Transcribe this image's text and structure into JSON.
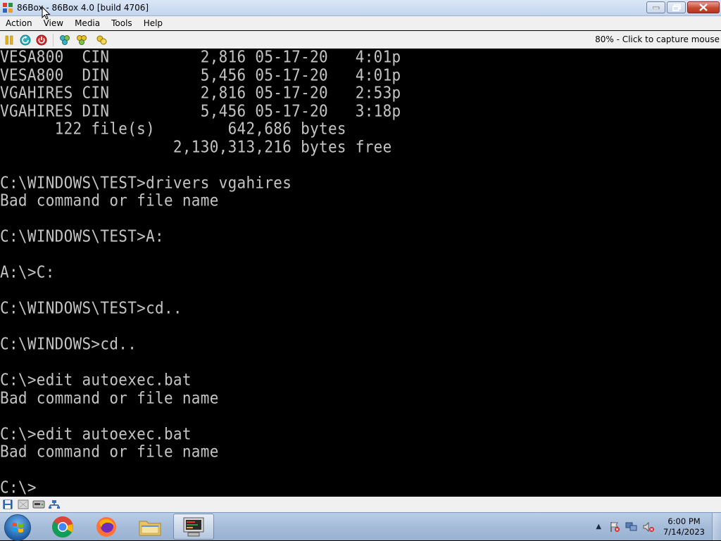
{
  "window": {
    "title": "86Box - 86Box 4.0 [build 4706]",
    "accent_color": "#c3d5ee"
  },
  "menu": {
    "items": [
      "Action",
      "View",
      "Media",
      "Tools",
      "Help"
    ]
  },
  "toolbar": {
    "icons": [
      "pause-icon",
      "reset-icon",
      "power-off-icon",
      "settings-icon",
      "ctrl-alt-del-icon",
      "ctrl-alt-esc-icon"
    ],
    "status_text": "80% - Click to capture mouse"
  },
  "dos": {
    "text_color": "#c4c4c4",
    "lines": [
      "VESA800  CIN          2,816 05-17-20   4:01p",
      "VESA800  DIN          5,456 05-17-20   4:01p",
      "VGAHIRES CIN          2,816 05-17-20   2:53p",
      "VGAHIRES DIN          5,456 05-17-20   3:18p",
      "      122 file(s)        642,686 bytes",
      "                   2,130,313,216 bytes free",
      "",
      "C:\\WINDOWS\\TEST>drivers vgahires",
      "Bad command or file name",
      "",
      "C:\\WINDOWS\\TEST>A:",
      "",
      "A:\\>C:",
      "",
      "C:\\WINDOWS\\TEST>cd..",
      "",
      "C:\\WINDOWS>cd..",
      "",
      "C:\\>edit autoexec.bat",
      "Bad command or file name",
      "",
      "C:\\>edit autoexec.bat",
      "Bad command or file name",
      "",
      "C:\\>"
    ]
  },
  "statusbar": {
    "icons": [
      "floppy-drive-icon",
      "cdrom-drive-icon",
      "hard-disk-icon",
      "network-icon"
    ]
  },
  "taskbar": {
    "apps": [
      "start-button",
      "chrome-icon",
      "firefox-icon",
      "file-explorer-icon",
      "86box-icon"
    ],
    "tray_icons": [
      "action-center-icon",
      "network-tray-icon",
      "volume-muted-icon"
    ],
    "clock_time": "6:00 PM",
    "clock_date": "7/14/2023"
  }
}
